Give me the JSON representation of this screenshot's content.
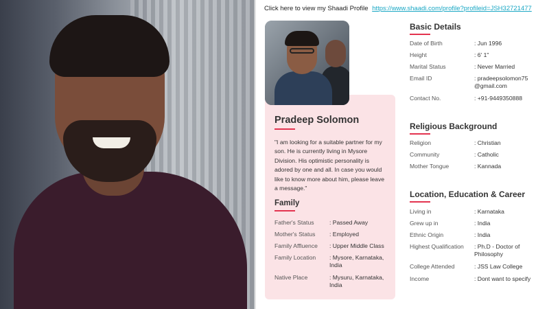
{
  "header": {
    "prefix": "Click here to view my Shaadi Profile",
    "link": "https://www.shaadi.com/profile?profileid=JSH32721477"
  },
  "profile": {
    "name": "Pradeep Solomon",
    "about": "\"I am looking for a suitable partner for my son. He is currently living in Mysore Division. His optimistic personality is adored by one and all. In case you would like to know more about him, please leave a message.\""
  },
  "family": {
    "title": "Family",
    "rows": [
      {
        "k": "Father's Status",
        "v": ": Passed Away"
      },
      {
        "k": "Mother's Status",
        "v": ": Employed"
      },
      {
        "k": "Family Affluence",
        "v": ": Upper Middle Class"
      },
      {
        "k": "Family Location",
        "v": ": Mysore, Karnataka, India"
      },
      {
        "k": "Native Place",
        "v": ": Mysuru, Karnataka, India"
      }
    ]
  },
  "basic": {
    "title": "Basic Details",
    "rows": [
      {
        "k": "Date of Birth",
        "v": ": Jun 1996"
      },
      {
        "k": "Height",
        "v": ": 6' 1\""
      },
      {
        "k": "Marital Status",
        "v": ": Never Married"
      },
      {
        "k": "Email ID",
        "v": ": pradeepsolomon75@gmail.com"
      },
      {
        "k": "Contact No.",
        "v": ": +91-9449350888"
      }
    ]
  },
  "religious": {
    "title": "Religious Background",
    "rows": [
      {
        "k": "Religion",
        "v": ": Christian"
      },
      {
        "k": "Community",
        "v": ": Catholic"
      },
      {
        "k": "Mother Tongue",
        "v": ": Kannada"
      }
    ]
  },
  "location": {
    "title": "Location, Education & Career",
    "rows": [
      {
        "k": "Living in",
        "v": ": Karnataka"
      },
      {
        "k": "Grew up in",
        "v": ": India"
      },
      {
        "k": "Ethnic Origin",
        "v": ": India"
      },
      {
        "k": "Highest Qualification",
        "v": ": Ph.D - Doctor of Philosophy"
      },
      {
        "k": "College Attended",
        "v": ": JSS Law College"
      },
      {
        "k": "Income",
        "v": ": Dont want to specify"
      }
    ]
  },
  "colors": {
    "accent": "#e3334f",
    "link": "#19a7c4",
    "card_bg": "#fbe3e6"
  }
}
